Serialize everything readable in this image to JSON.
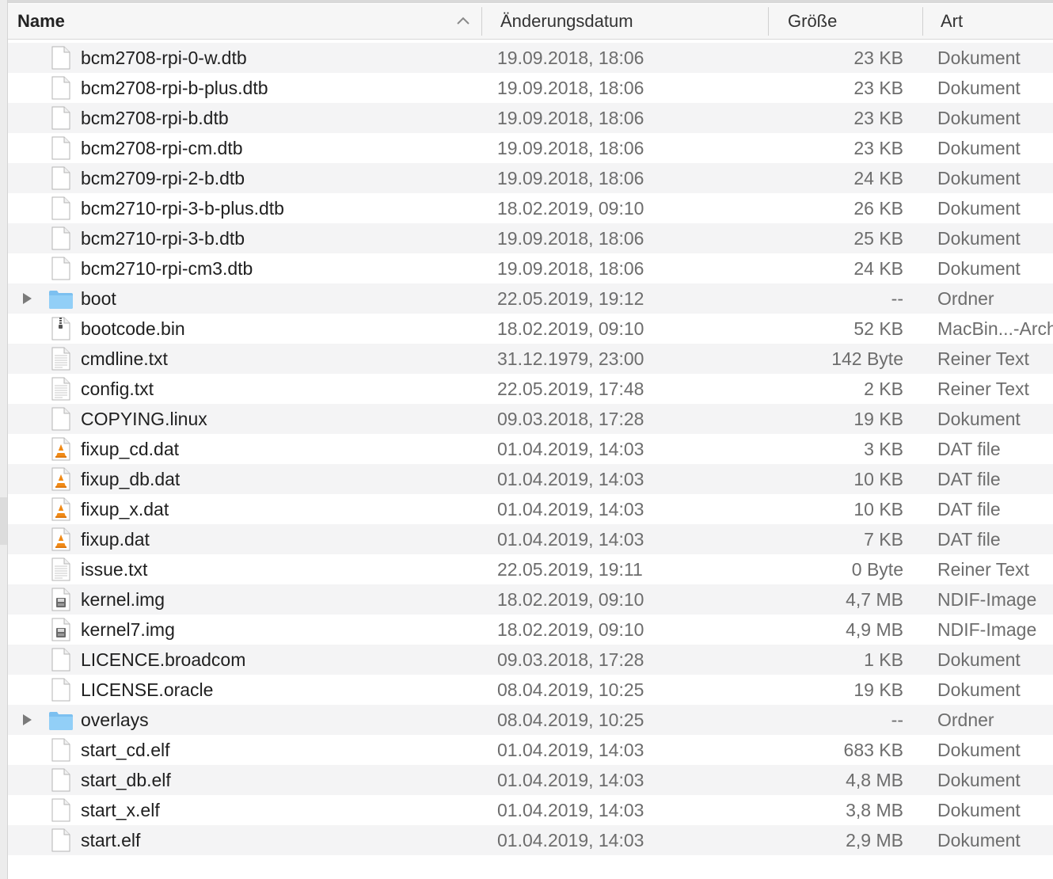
{
  "columns": {
    "name": "Name",
    "date": "Änderungsdatum",
    "size": "Größe",
    "kind": "Art",
    "sort": "ascending"
  },
  "files": [
    {
      "name": "bcm2708-rpi-0-w.dtb",
      "date": "19.09.2018, 18:06",
      "size": "23 KB",
      "kind": "Dokument",
      "icon": "document-icon"
    },
    {
      "name": "bcm2708-rpi-b-plus.dtb",
      "date": "19.09.2018, 18:06",
      "size": "23 KB",
      "kind": "Dokument",
      "icon": "document-icon"
    },
    {
      "name": "bcm2708-rpi-b.dtb",
      "date": "19.09.2018, 18:06",
      "size": "23 KB",
      "kind": "Dokument",
      "icon": "document-icon"
    },
    {
      "name": "bcm2708-rpi-cm.dtb",
      "date": "19.09.2018, 18:06",
      "size": "23 KB",
      "kind": "Dokument",
      "icon": "document-icon"
    },
    {
      "name": "bcm2709-rpi-2-b.dtb",
      "date": "19.09.2018, 18:06",
      "size": "24 KB",
      "kind": "Dokument",
      "icon": "document-icon"
    },
    {
      "name": "bcm2710-rpi-3-b-plus.dtb",
      "date": "18.02.2019, 09:10",
      "size": "26 KB",
      "kind": "Dokument",
      "icon": "document-icon"
    },
    {
      "name": "bcm2710-rpi-3-b.dtb",
      "date": "19.09.2018, 18:06",
      "size": "25 KB",
      "kind": "Dokument",
      "icon": "document-icon"
    },
    {
      "name": "bcm2710-rpi-cm3.dtb",
      "date": "19.09.2018, 18:06",
      "size": "24 KB",
      "kind": "Dokument",
      "icon": "document-icon"
    },
    {
      "name": "boot",
      "date": "22.05.2019, 19:12",
      "size": "--",
      "kind": "Ordner",
      "icon": "folder-icon"
    },
    {
      "name": "bootcode.bin",
      "date": "18.02.2019, 09:10",
      "size": "52 KB",
      "kind": "MacBin...-Archiv",
      "icon": "archive-icon"
    },
    {
      "name": "cmdline.txt",
      "date": "31.12.1979, 23:00",
      "size": "142 Byte",
      "kind": "Reiner Text",
      "icon": "text-file-icon"
    },
    {
      "name": "config.txt",
      "date": "22.05.2019, 17:48",
      "size": "2 KB",
      "kind": "Reiner Text",
      "icon": "text-file-icon"
    },
    {
      "name": "COPYING.linux",
      "date": "09.03.2018, 17:28",
      "size": "19 KB",
      "kind": "Dokument",
      "icon": "document-icon"
    },
    {
      "name": "fixup_cd.dat",
      "date": "01.04.2019, 14:03",
      "size": "3 KB",
      "kind": "DAT file",
      "icon": "vlc-file-icon"
    },
    {
      "name": "fixup_db.dat",
      "date": "01.04.2019, 14:03",
      "size": "10 KB",
      "kind": "DAT file",
      "icon": "vlc-file-icon"
    },
    {
      "name": "fixup_x.dat",
      "date": "01.04.2019, 14:03",
      "size": "10 KB",
      "kind": "DAT file",
      "icon": "vlc-file-icon"
    },
    {
      "name": "fixup.dat",
      "date": "01.04.2019, 14:03",
      "size": "7 KB",
      "kind": "DAT file",
      "icon": "vlc-file-icon"
    },
    {
      "name": "issue.txt",
      "date": "22.05.2019, 19:11",
      "size": "0 Byte",
      "kind": "Reiner Text",
      "icon": "text-file-icon"
    },
    {
      "name": "kernel.img",
      "date": "18.02.2019, 09:10",
      "size": "4,7 MB",
      "kind": "NDIF-Image",
      "icon": "disk-image-icon"
    },
    {
      "name": "kernel7.img",
      "date": "18.02.2019, 09:10",
      "size": "4,9 MB",
      "kind": "NDIF-Image",
      "icon": "disk-image-icon"
    },
    {
      "name": "LICENCE.broadcom",
      "date": "09.03.2018, 17:28",
      "size": "1 KB",
      "kind": "Dokument",
      "icon": "document-icon"
    },
    {
      "name": "LICENSE.oracle",
      "date": "08.04.2019, 10:25",
      "size": "19 KB",
      "kind": "Dokument",
      "icon": "document-icon"
    },
    {
      "name": "overlays",
      "date": "08.04.2019, 10:25",
      "size": "--",
      "kind": "Ordner",
      "icon": "folder-icon"
    },
    {
      "name": "start_cd.elf",
      "date": "01.04.2019, 14:03",
      "size": "683 KB",
      "kind": "Dokument",
      "icon": "document-icon"
    },
    {
      "name": "start_db.elf",
      "date": "01.04.2019, 14:03",
      "size": "4,8 MB",
      "kind": "Dokument",
      "icon": "document-icon"
    },
    {
      "name": "start_x.elf",
      "date": "01.04.2019, 14:03",
      "size": "3,8 MB",
      "kind": "Dokument",
      "icon": "document-icon"
    },
    {
      "name": "start.elf",
      "date": "01.04.2019, 14:03",
      "size": "2,9 MB",
      "kind": "Dokument",
      "icon": "document-icon"
    }
  ]
}
